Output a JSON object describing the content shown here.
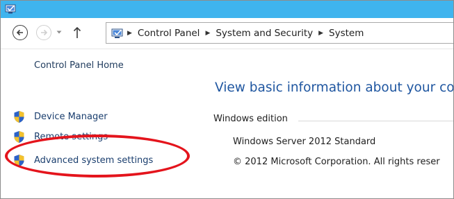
{
  "nav": {
    "breadcrumbs": [
      "Control Panel",
      "System and Security",
      "System"
    ]
  },
  "sidebar": {
    "home_label": "Control Panel Home",
    "links": [
      {
        "label": "Device Manager",
        "icon": "shield-icon"
      },
      {
        "label": "Remote settings",
        "icon": "shield-icon"
      },
      {
        "label": "Advanced system settings",
        "icon": "shield-icon",
        "highlighted": true
      }
    ]
  },
  "main": {
    "title": "View basic information about your co",
    "section_header": "Windows edition",
    "edition": "Windows Server 2012 Standard",
    "copyright": "© 2012 Microsoft Corporation. All rights reser"
  },
  "colors": {
    "titlebar": "#3fb4ee",
    "link": "#1a3e6e",
    "heading": "#1f56a0",
    "highlight": "#e4141c"
  }
}
